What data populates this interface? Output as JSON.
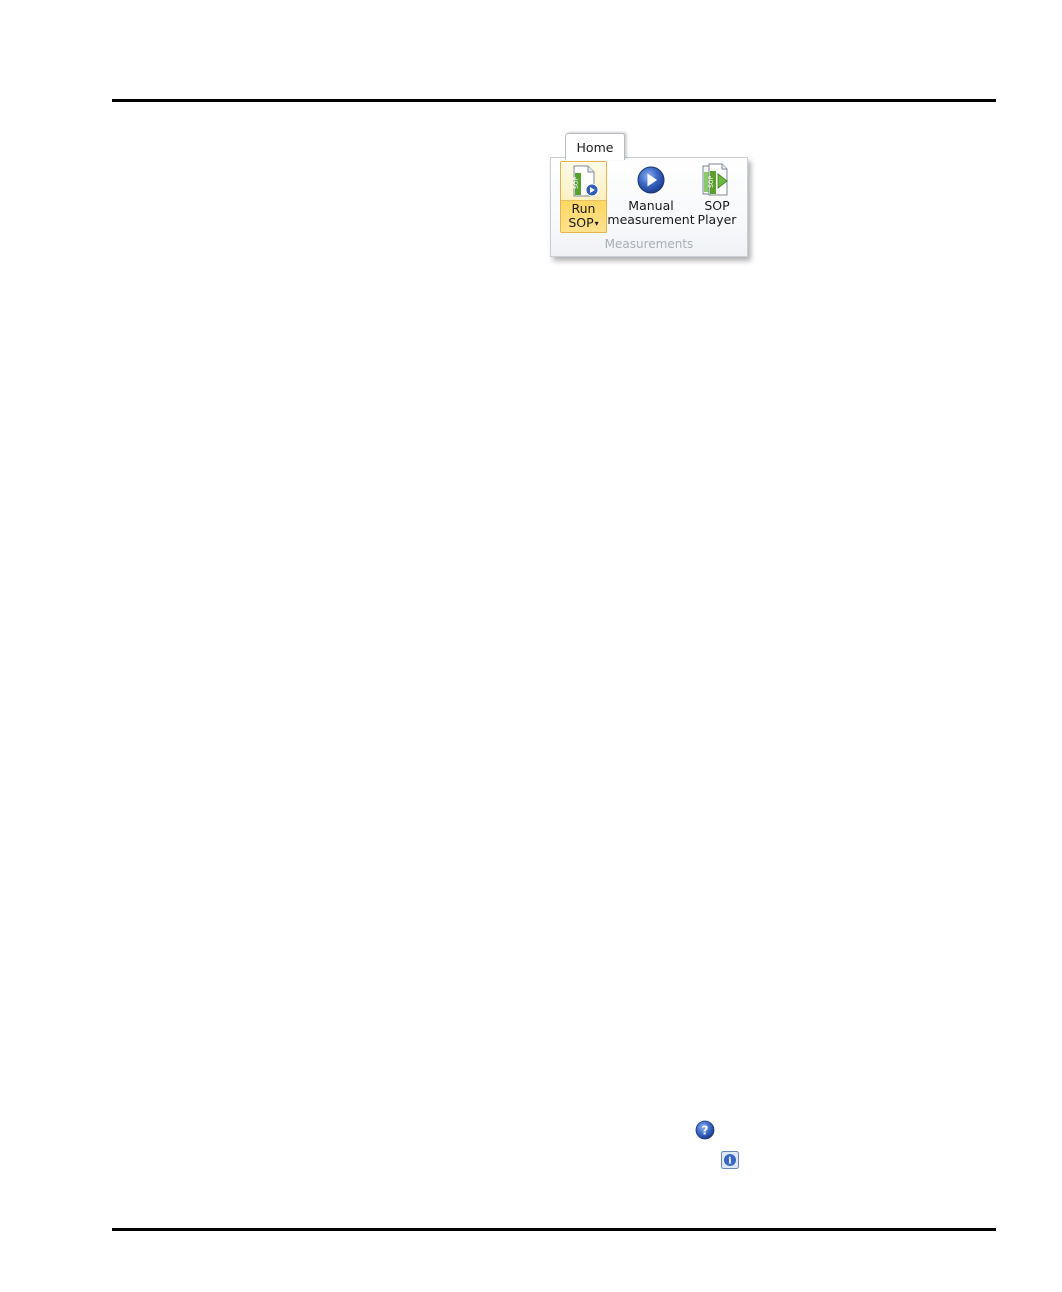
{
  "ribbon": {
    "tabs": [
      {
        "label": "Home",
        "selected": true
      }
    ],
    "groups": [
      {
        "label": "Measurements",
        "buttons": [
          {
            "id": "run_sop",
            "line1": "Run",
            "line2": "SOP",
            "has_dropdown": true,
            "dropdown_glyph": "▾",
            "icon": "sop-run-icon",
            "highlighted": true
          },
          {
            "id": "manual_measurement",
            "line1": "Manual",
            "line2": "measurement",
            "icon": "play-circle-icon"
          },
          {
            "id": "sop_player",
            "line1": "SOP",
            "line2": "Player",
            "icon": "sop-player-icon"
          }
        ]
      }
    ]
  },
  "page_icons": [
    {
      "name": "help-icon",
      "glyph": "?"
    },
    {
      "name": "info-icon",
      "glyph": "i"
    }
  ],
  "colors": {
    "highlight": "#ffd65e",
    "icon_blue": "#2f5db8",
    "sop_green": "#5aa02c"
  }
}
